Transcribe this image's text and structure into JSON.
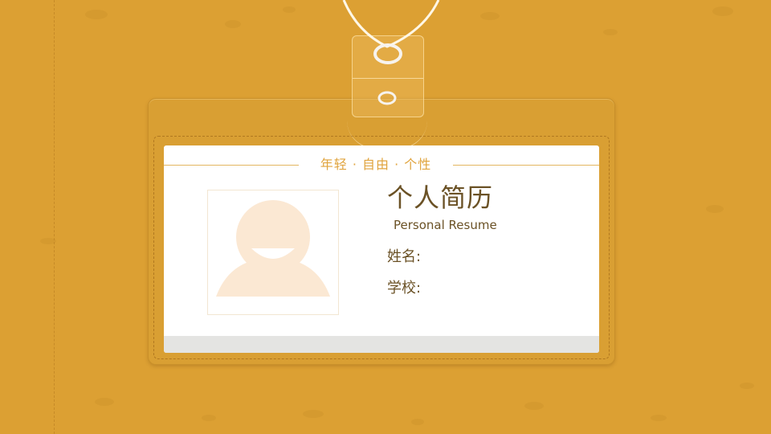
{
  "card": {
    "slogan": "年轻 ·  自由 · 个性",
    "title": "个人简历",
    "subtitle": "Personal Resume",
    "name_label": "姓名:",
    "school_label": "学校:"
  },
  "colors": {
    "background": "#DCA033",
    "card": "#FFFFFF",
    "title_text": "#6B5226",
    "accent": "#E0A43E",
    "avatar": "#FBE8D3"
  },
  "icons": {
    "photo_placeholder": "user-avatar-icon",
    "lanyard": "lanyard-cord",
    "grommet": "ring-icon"
  }
}
